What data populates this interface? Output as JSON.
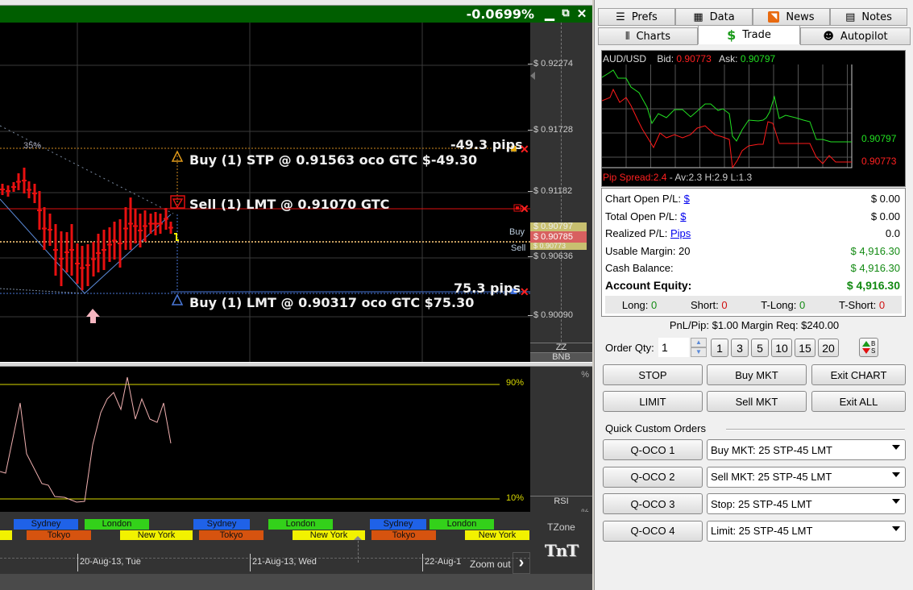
{
  "chart_window": {
    "change_pct": "-0.0699%",
    "controls": {
      "minimize": "▁",
      "restore": "🗗",
      "close": "✕"
    },
    "price_axis": [
      "$ 0.92274",
      "$ 0.91728",
      "$ 0.91182",
      "$ 0.90636",
      "$ 0.90090"
    ],
    "current_price": "$ 0.90785",
    "ask_tag": "$ 0.90797",
    "bid_tag": "$ 0.90773",
    "buy_label": "Buy",
    "sell_label": "Sell",
    "fib_label": "35%",
    "orders": [
      {
        "text": "Buy (1) STP @ 0.91563 oco GTC  $-49.30",
        "pips": "-49.3 pips",
        "color": "#e09a1a"
      },
      {
        "text": "Sell (1) LMT @ 0.91070 GTC",
        "pips": "",
        "color": "#e01010"
      },
      {
        "text": "Buy (1) LMT @ 0.90317 oco GTC  $75.30",
        "pips": "75.3 pips",
        "color": "#4a78d8"
      }
    ],
    "indicator_buttons": {
      "zz": "ZZ",
      "bnb": "BNB",
      "rsi": "RSI",
      "pct_top": "%",
      "pct_bottom": "%",
      "tzone": "TZone",
      "logo": "TnT"
    },
    "rsi_levels": {
      "upper": "90%",
      "lower": "10%"
    },
    "sessions_row1": [
      {
        "label": "Sydney",
        "color": "#1f62e8"
      },
      {
        "label": "London",
        "color": "#33d11a"
      },
      {
        "label": "Sydney",
        "color": "#1f62e8"
      },
      {
        "label": "London",
        "color": "#33d11a"
      },
      {
        "label": "Sydney",
        "color": "#1f62e8"
      },
      {
        "label": "London",
        "color": "#33d11a"
      }
    ],
    "sessions_row2": [
      {
        "label": "Tokyo",
        "color": "#d6530f"
      },
      {
        "label": "New York",
        "color": "#f2f200"
      },
      {
        "label": "Tokyo",
        "color": "#d6530f"
      },
      {
        "label": "New York",
        "color": "#f2f200"
      },
      {
        "label": "Tokyo",
        "color": "#d6530f"
      },
      {
        "label": "New York",
        "color": "#f2f200"
      }
    ],
    "time_labels": [
      "20-Aug-13, Tue",
      "21-Aug-13, Wed",
      "22-Aug-1"
    ],
    "zoom_out": "Zoom out",
    "next": "›"
  },
  "right_panel": {
    "tabs_row1": [
      {
        "label": "Prefs",
        "icon": "prefs-icon",
        "glyph": "☰"
      },
      {
        "label": "Data",
        "icon": "data-icon",
        "glyph": "▦"
      },
      {
        "label": "News",
        "icon": "rss-icon",
        "glyph": "◥"
      },
      {
        "label": "Notes",
        "icon": "notes-icon",
        "glyph": "▤"
      }
    ],
    "tabs_row2": [
      {
        "label": "Charts",
        "icon": "charts-icon",
        "glyph": "⫴"
      },
      {
        "label": "Trade",
        "icon": "dollar-icon",
        "glyph": "$",
        "active": true
      },
      {
        "label": "Autopilot",
        "icon": "autopilot-icon",
        "glyph": "☻"
      }
    ],
    "ticker": {
      "symbol": "AUD/USD",
      "bid_label": "Bid:",
      "bid": "0.90773",
      "ask_label": "Ask:",
      "ask": "0.90797",
      "ask_last": "0.90797",
      "bid_last": "0.90773",
      "spread_label": "Pip Spread:2.4",
      "spread_stats": " - Av:2.3  H:2.9  L:1.3"
    },
    "stats": [
      {
        "label": "Chart Open P/L:",
        "link": "$",
        "value": "$ 0.00",
        "color": "#000"
      },
      {
        "label": "Total Open P/L:",
        "link": "$",
        "value": "$ 0.00",
        "color": "#000"
      },
      {
        "label": "Realized P/L:",
        "link": "Pips",
        "value": "0.0",
        "color": "#000"
      },
      {
        "label": "Usable Margin: 20",
        "link": "",
        "value": "$ 4,916.30",
        "color": "#138a13"
      },
      {
        "label": "Cash Balance:",
        "link": "",
        "value": "$ 4,916.30",
        "color": "#138a13"
      },
      {
        "label": "Account Equity:",
        "link": "",
        "value": "$ 4,916.30",
        "color": "#138a13",
        "bold": true
      }
    ],
    "positions": [
      {
        "label": "Long:",
        "value": "0",
        "color": "#138a13"
      },
      {
        "label": "Short:",
        "value": "0",
        "color": "#d01010"
      },
      {
        "label": "T-Long:",
        "value": "0",
        "color": "#138a13"
      },
      {
        "label": "T-Short:",
        "value": "0",
        "color": "#d01010"
      }
    ],
    "pnl_line": "PnL/Pip:  $1.00   Margin Req:  $240.00",
    "order_qty_label": "Order Qty:",
    "order_qty_value": "1",
    "qty_presets": [
      "1",
      "3",
      "5",
      "10",
      "15",
      "20"
    ],
    "action_buttons": [
      [
        "STOP",
        "Buy MKT",
        "Exit CHART"
      ],
      [
        "LIMIT",
        "Sell MKT",
        "Exit ALL"
      ]
    ],
    "quick_orders_title": "Quick Custom Orders",
    "quick_orders": [
      {
        "button": "Q-OCO 1",
        "selected": "Buy MKT: 25 STP-45 LMT"
      },
      {
        "button": "Q-OCO 2",
        "selected": "Sell MKT: 25 STP-45 LMT"
      },
      {
        "button": "Q-OCO 3",
        "selected": "Stop: 25 STP-45 LMT"
      },
      {
        "button": "Q-OCO 4",
        "selected": "Limit: 25 STP-45 LMT"
      }
    ]
  }
}
